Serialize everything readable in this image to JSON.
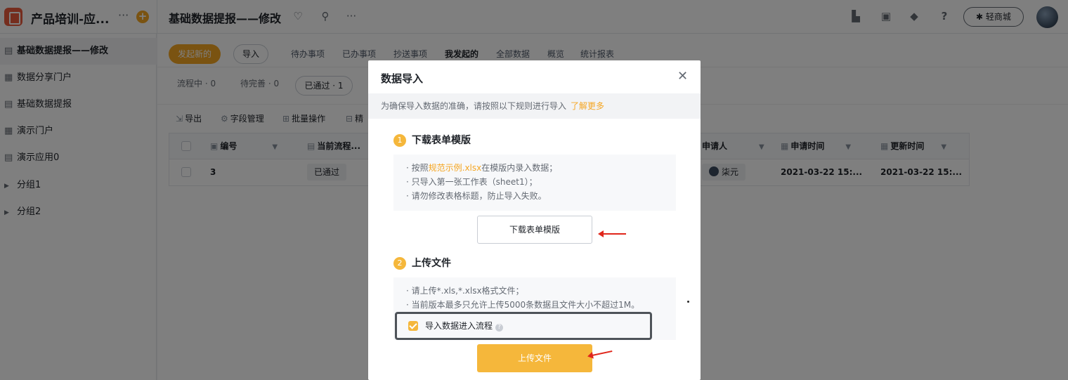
{
  "app": {
    "title": "产品培训-应...",
    "more_icon": "more-icon",
    "add_icon": "add-icon"
  },
  "header": {
    "page_title": "基础数据提报——修改",
    "store_label": "轻商城",
    "icons": [
      "favorite-icon",
      "wrench-icon",
      "more-icon",
      "building-icon",
      "contacts-icon",
      "bell-icon",
      "help-icon",
      "avatar"
    ]
  },
  "sidebar": {
    "items": [
      {
        "label": "基础数据提报——修改",
        "icon": "form-icon",
        "active": true
      },
      {
        "label": "数据分享门户",
        "icon": "portal-icon"
      },
      {
        "label": "基础数据提报",
        "icon": "form-icon"
      },
      {
        "label": "演示门户",
        "icon": "portal-icon"
      },
      {
        "label": "演示应用0",
        "icon": "form-icon"
      },
      {
        "label": "分组1",
        "icon": "expand-arrow-icon"
      },
      {
        "label": "分组2",
        "icon": "expand-arrow-icon"
      }
    ]
  },
  "actions": {
    "new_label": "发起新的",
    "import_label": "导入"
  },
  "tabs": [
    "待办事项",
    "已办事项",
    "抄送事项",
    "我发起的",
    "全部数据",
    "概览",
    "统计报表"
  ],
  "active_tab": "我发起的",
  "status_filters": {
    "in_flow": "流程中 · 0",
    "pending": "待完善 · 0",
    "approved": "已通过 · 1"
  },
  "toolbar": {
    "export": "导出",
    "fields": "字段管理",
    "batch": "批量操作",
    "cut": "精"
  },
  "table": {
    "headers": [
      "编号",
      "当前流程...",
      "申请人",
      "申请时间",
      "更新时间"
    ],
    "row": {
      "id": "3",
      "status": "已通过",
      "applicant": "柒元",
      "apply_time": "2021-03-22 15:...",
      "update_time": "2021-03-22 15:..."
    }
  },
  "modal": {
    "title": "数据导入",
    "notice": "为确保导入数据的准确，请按照以下规则进行导入",
    "notice_link": "了解更多",
    "step1": {
      "num": "1",
      "title": "下载表单模版"
    },
    "rules1": {
      "r1_prefix": "· 按照",
      "r1_link": "规范示例.xlsx",
      "r1_suffix": "在模版内录入数据；",
      "r2": "· 只导入第一张工作表（sheet1）；",
      "r3": "· 请勿修改表格标题，防止导入失败。"
    },
    "download_btn": "下载表单模版",
    "step2": {
      "num": "2",
      "title": "上传文件"
    },
    "rules2": {
      "r1": "· 请上传*.xls,*.xlsx格式文件；",
      "r2": "· 当前版本最多只允许上传5000条数据且文件大小不超过1M。"
    },
    "checkbox_label": "导入数据进入流程",
    "upload_btn": "上传文件"
  },
  "colors": {
    "accent": "#f5a623",
    "accent_light": "#f5b73b",
    "arrow": "#e0261b"
  }
}
